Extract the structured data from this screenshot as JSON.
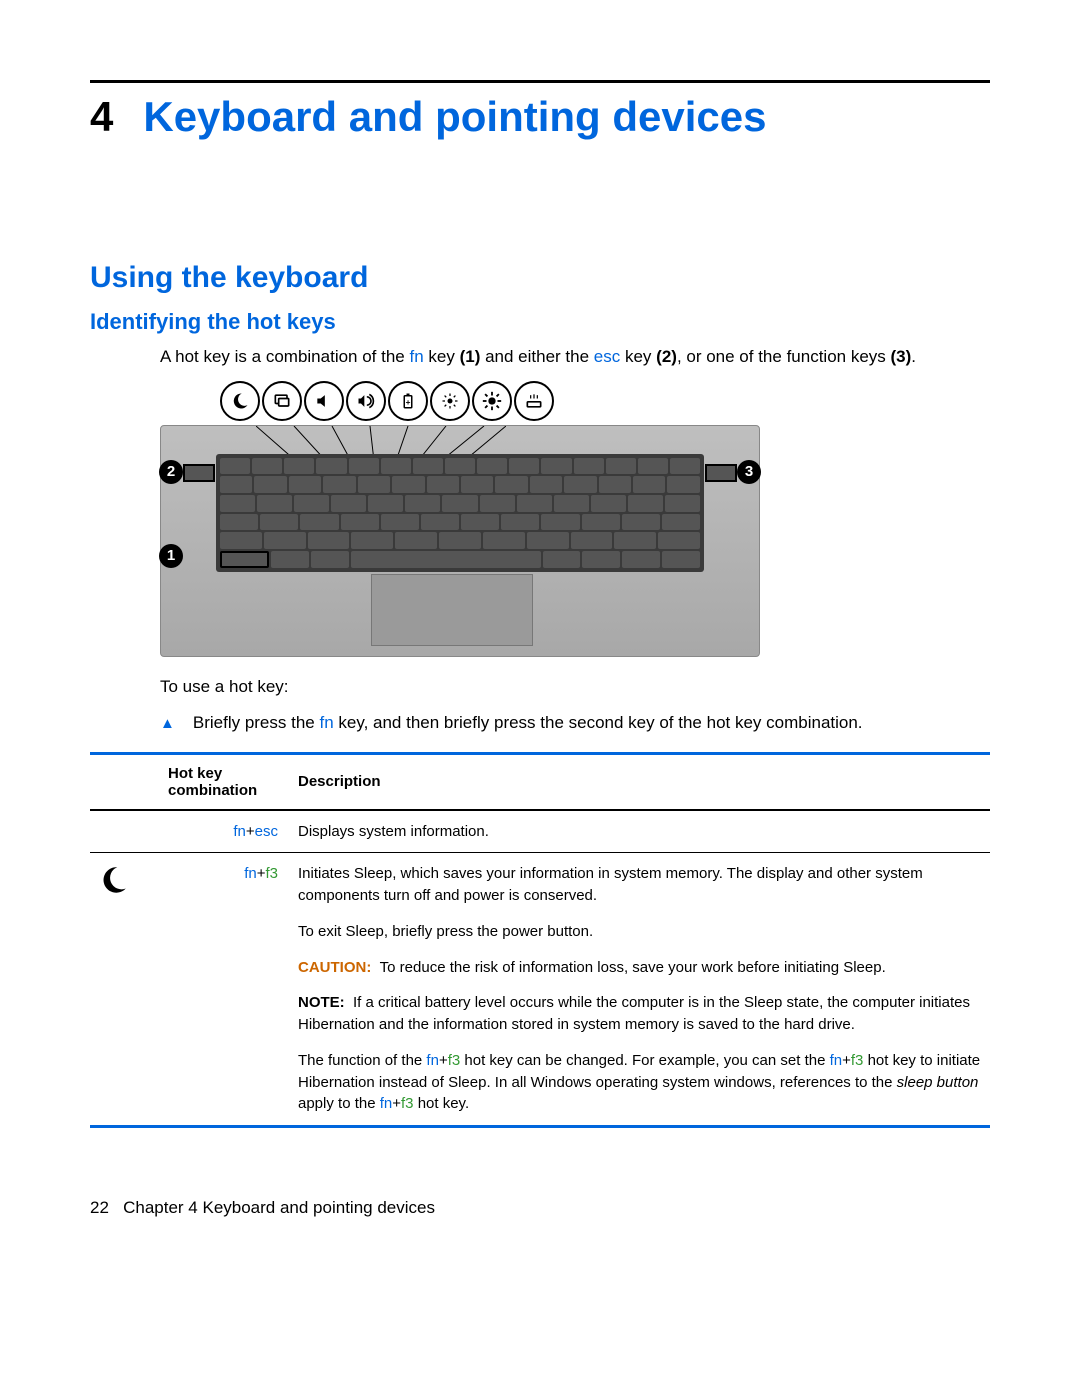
{
  "chapter": {
    "number": "4",
    "title": "Keyboard and pointing devices"
  },
  "section": "Using the keyboard",
  "subsection": "Identifying the hot keys",
  "intro": {
    "pre": "A hot key is a combination of the ",
    "fn": "fn",
    "mid1": " key ",
    "b1": "(1)",
    "mid2": " and either the ",
    "esc": "esc",
    "mid3": " key ",
    "b2": "(2)",
    "mid4": ", or one of the function keys ",
    "b3": "(3)",
    "end": "."
  },
  "callouts": {
    "c1": "1",
    "c2": "2",
    "c3": "3"
  },
  "to_use": "To use a hot key:",
  "step": {
    "pre": "Briefly press the ",
    "fn": "fn",
    "post": " key, and then briefly press the second key of the hot key combination."
  },
  "table": {
    "h1": "Hot key combination",
    "h2": "Description",
    "rows": [
      {
        "combo_a": "fn",
        "combo_plus": "+",
        "combo_b": "esc",
        "desc_simple": "Displays system information."
      },
      {
        "combo_a": "fn",
        "combo_plus": "+",
        "combo_b": "f3",
        "p1": "Initiates Sleep, which saves your information in system memory. The display and other system components turn off and power is conserved.",
        "p2": "To exit Sleep, briefly press the power button.",
        "caution_label": "CAUTION:",
        "caution_text": "To reduce the risk of information loss, save your work before initiating Sleep.",
        "note_label": "NOTE:",
        "note_text": "If a critical battery level occurs while the computer is in the Sleep state, the computer initiates Hibernation and the information stored in system memory is saved to the hard drive.",
        "func_pre": "The function of the ",
        "func_mid1": " hot key can be changed. For example, you can set the ",
        "func_mid2": " hot key to initiate Hibernation instead of Sleep. In all Windows operating system windows, references to the ",
        "sleep_btn": "sleep button",
        "func_mid3": " apply to the ",
        "func_end": " hot key."
      }
    ]
  },
  "footer": {
    "page": "22",
    "label": "Chapter 4   Keyboard and pointing devices"
  }
}
